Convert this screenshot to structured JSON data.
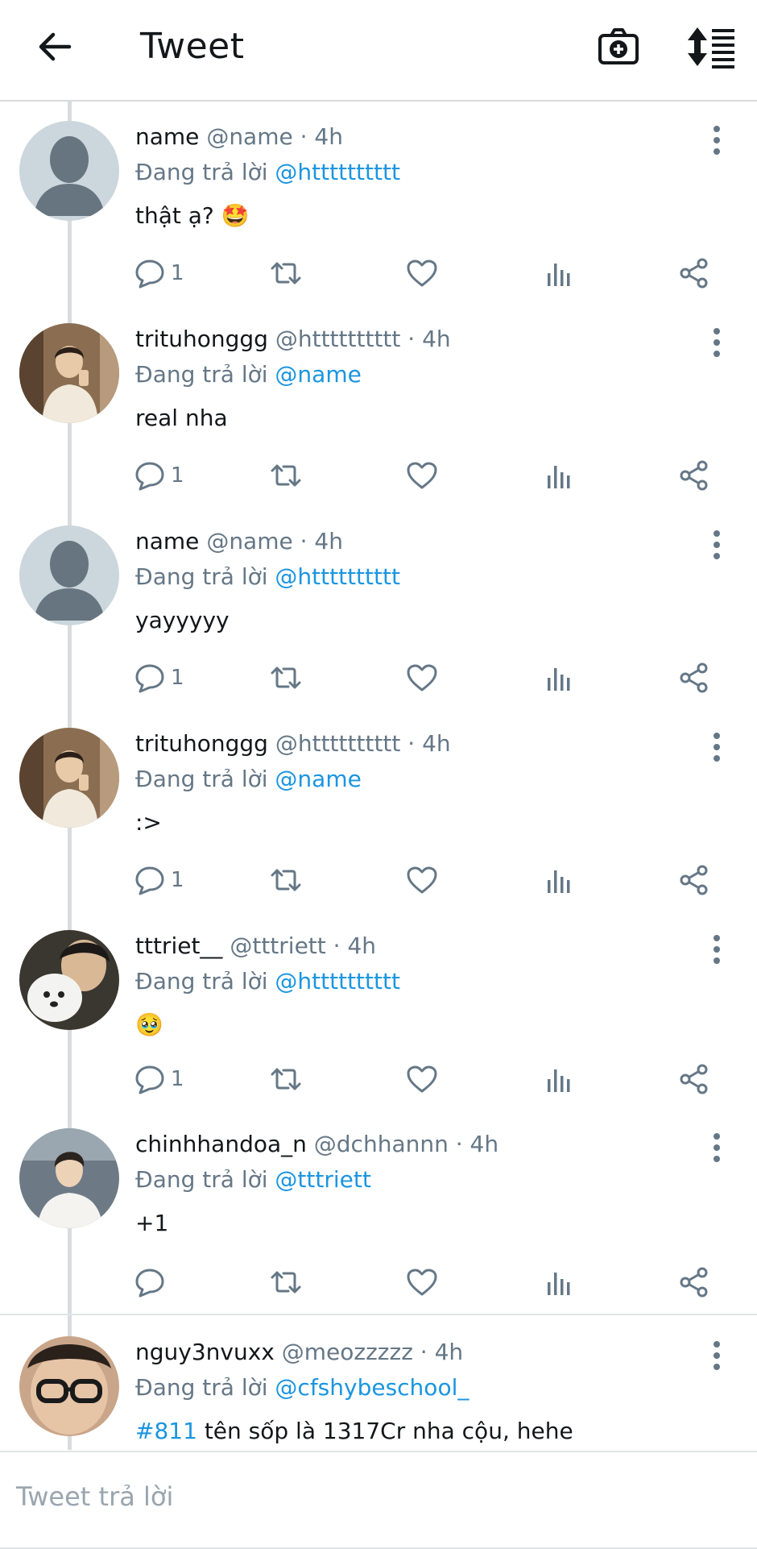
{
  "header": {
    "title": "Tweet",
    "back_icon": "arrow-left-icon",
    "camera_icon": "camera-plus-icon",
    "sort_icon": "sort-list-icon"
  },
  "colors": {
    "link": "#1b95e0",
    "muted": "#657786",
    "thread_line": "#d9dcdf"
  },
  "tweets": [
    {
      "name": "name",
      "handle_time": "@name · 4h",
      "reply_prefix": "Đang trả lời",
      "reply_to": "@htttttttttt",
      "text": "thật ạ? 🤩",
      "reply_count": "1",
      "avatar": "default-avatar"
    },
    {
      "name": "trituhonggg",
      "handle_time": "@htttttttttt · 4h",
      "reply_prefix": "Đang trả lời",
      "reply_to": "@name",
      "text": "real nha",
      "reply_count": "1",
      "avatar": "photo-avatar"
    },
    {
      "name": "name",
      "handle_time": "@name · 4h",
      "reply_prefix": "Đang trả lời",
      "reply_to": "@htttttttttt",
      "text": "yayyyyy",
      "reply_count": "1",
      "avatar": "default-avatar"
    },
    {
      "name": "trituhonggg",
      "handle_time": "@htttttttttt · 4h",
      "reply_prefix": "Đang trả lời",
      "reply_to": "@name",
      "text": ":>",
      "reply_count": "1",
      "avatar": "photo-avatar"
    },
    {
      "name": "tttriet__",
      "handle_time": "@tttriett · 4h",
      "reply_prefix": "Đang trả lời",
      "reply_to": "@htttttttttt",
      "text": "🥹",
      "reply_count": "1",
      "avatar": "photo-avatar"
    },
    {
      "name": "chinhhandoa_n",
      "handle_time": "@dchhannn · 4h",
      "reply_prefix": "Đang trả lời",
      "reply_to": "@tttriett",
      "text": "+1",
      "reply_count": "",
      "avatar": "photo-avatar"
    },
    {
      "name": "nguy3nvuxx",
      "handle_time": "@meozzzzz · 4h",
      "reply_prefix": "Đang trả lời",
      "reply_to": "@cfshybeschool_",
      "hashtag": "#811",
      "text": "tên sốp là 1317Cr nha cộu, hehe",
      "avatar": "photo-avatar"
    }
  ],
  "compose": {
    "placeholder": "Tweet trả lời"
  }
}
